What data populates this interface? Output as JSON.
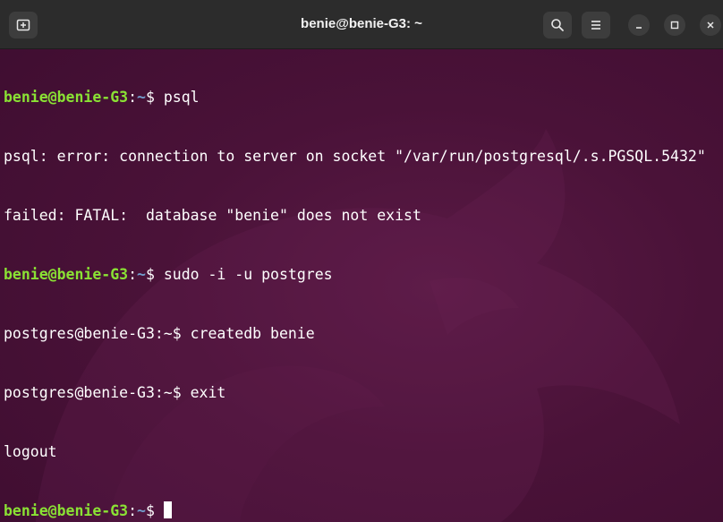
{
  "window": {
    "title": "benie@benie-G3: ~"
  },
  "titlebar": {
    "icons": {
      "new_tab": "new-tab-icon",
      "search": "search-icon",
      "menu": "hamburger-menu-icon",
      "minimize": "minimize-icon",
      "maximize": "maximize-icon",
      "close": "close-icon"
    }
  },
  "colors": {
    "background": "#4a1238",
    "prompt_user": "#8ae234",
    "prompt_path": "#729fcf",
    "text": "#ffffff",
    "titlebar": "#2c2c2c"
  },
  "terminal": {
    "lines": [
      {
        "user": "benie@benie-G3",
        "sep": ":",
        "path": "~",
        "dollar": "$ ",
        "cmd": "psql"
      },
      {
        "text": "psql: error: connection to server on socket \"/var/run/postgresql/.s.PGSQL.5432\""
      },
      {
        "text": "failed: FATAL:  database \"benie\" does not exist"
      },
      {
        "user": "benie@benie-G3",
        "sep": ":",
        "path": "~",
        "dollar": "$ ",
        "cmd": "sudo -i -u postgres"
      },
      {
        "text": "postgres@benie-G3:~$ createdb benie"
      },
      {
        "text": "postgres@benie-G3:~$ exit"
      },
      {
        "text": "logout"
      },
      {
        "user": "benie@benie-G3",
        "sep": ":",
        "path": "~",
        "dollar": "$ ",
        "cmd": ""
      }
    ]
  }
}
